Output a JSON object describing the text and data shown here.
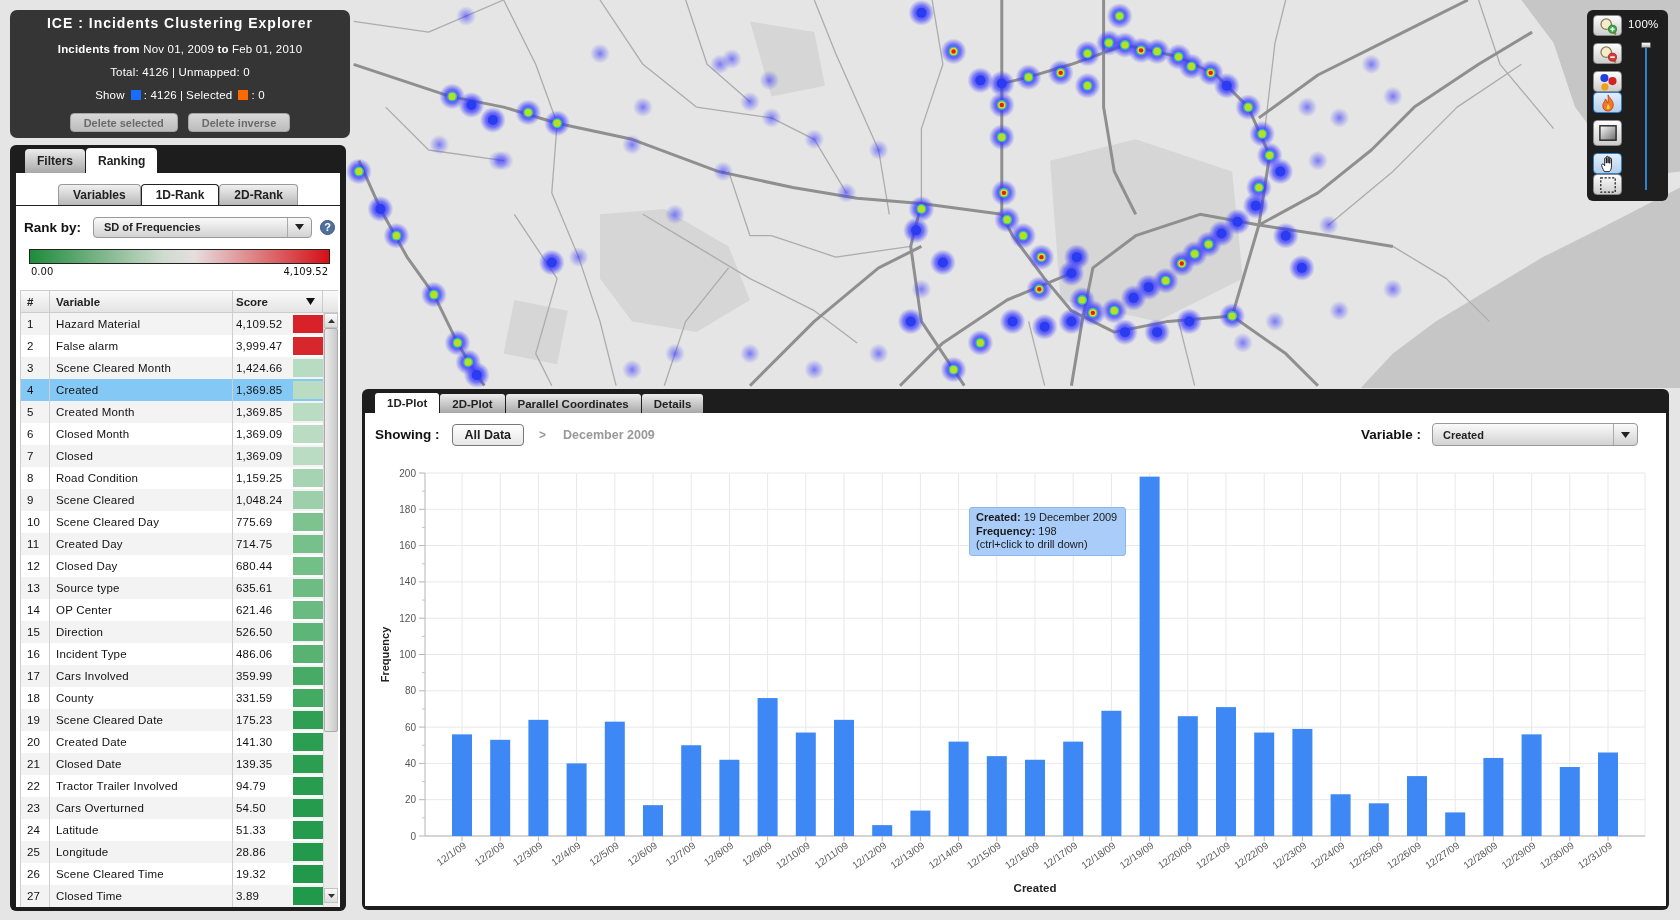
{
  "info_panel": {
    "title": "ICE : Incidents Clustering Explorer",
    "range": "**Incidents from** Nov 01, 2009 **to** Feb 01, 2010",
    "totals": "Total: 4126 | Unmapped: 0",
    "legend": [
      {
        "label": "Show",
        "color": "#1a6cff",
        "value": ": 4126"
      },
      {
        "label": "Selected",
        "color": "#ff6a00",
        "value": ": 0"
      }
    ],
    "legend_separator": "|",
    "buttons": [
      {
        "label": "Delete selected",
        "disabled": true
      },
      {
        "label": "Delete inverse",
        "disabled": true
      }
    ]
  },
  "ranking_panel": {
    "tabs": [
      {
        "label": "Filters",
        "selected": false
      },
      {
        "label": "Ranking",
        "selected": true
      }
    ],
    "subtabs": [
      {
        "label": "Variables",
        "selected": false
      },
      {
        "label": "1D-Rank",
        "selected": true
      },
      {
        "label": "2D-Rank",
        "selected": false
      }
    ],
    "rank_by": {
      "label": "Rank by:",
      "value": "SD of Frequencies",
      "help": "?"
    },
    "scale": {
      "min": "0.00",
      "max": "4,109.52"
    },
    "table": {
      "columns": [
        "#",
        "Variable",
        "Score"
      ],
      "rows": [
        {
          "rank": "1",
          "variable": "Hazard Material",
          "score": "4,109.52",
          "color": "#d7222a",
          "selected": false
        },
        {
          "rank": "2",
          "variable": "False alarm",
          "score": "3,999.47",
          "color": "#d8262d",
          "selected": false
        },
        {
          "rank": "3",
          "variable": "Scene Cleared Month",
          "score": "1,424.66",
          "color": "#b8dcc2",
          "selected": false
        },
        {
          "rank": "4",
          "variable": "Created",
          "score": "1,369.85",
          "color": "#b9dcc3",
          "selected": true
        },
        {
          "rank": "5",
          "variable": "Created Month",
          "score": "1,369.85",
          "color": "#b9dcc3",
          "selected": false
        },
        {
          "rank": "6",
          "variable": "Closed Month",
          "score": "1,369.09",
          "color": "#b9dcc3",
          "selected": false
        },
        {
          "rank": "7",
          "variable": "Closed",
          "score": "1,369.09",
          "color": "#b9dcc3",
          "selected": false
        },
        {
          "rank": "8",
          "variable": "Road Condition",
          "score": "1,159.25",
          "color": "#a6d4b2",
          "selected": false
        },
        {
          "rank": "9",
          "variable": "Scene Cleared",
          "score": "1,048.24",
          "color": "#9dd0aa",
          "selected": false
        },
        {
          "rank": "10",
          "variable": "Scene Cleared Day",
          "score": "775.69",
          "color": "#7cc38f",
          "selected": false
        },
        {
          "rank": "11",
          "variable": "Created Day",
          "score": "714.75",
          "color": "#76c18b",
          "selected": false
        },
        {
          "rank": "12",
          "variable": "Closed Day",
          "score": "680.44",
          "color": "#72bf87",
          "selected": false
        },
        {
          "rank": "13",
          "variable": "Source type",
          "score": "635.61",
          "color": "#6cbc83",
          "selected": false
        },
        {
          "rank": "14",
          "variable": "OP Center",
          "score": "621.46",
          "color": "#6abb81",
          "selected": false
        },
        {
          "rank": "15",
          "variable": "Direction",
          "score": "526.50",
          "color": "#5db577",
          "selected": false
        },
        {
          "rank": "16",
          "variable": "Incident Type",
          "score": "486.06",
          "color": "#58b373",
          "selected": false
        },
        {
          "rank": "17",
          "variable": "Cars Involved",
          "score": "359.99",
          "color": "#47ab65",
          "selected": false
        },
        {
          "rank": "18",
          "variable": "County",
          "score": "331.59",
          "color": "#43aa62",
          "selected": false
        },
        {
          "rank": "19",
          "variable": "Scene Cleared Date",
          "score": "175.23",
          "color": "#2f9f54",
          "selected": false
        },
        {
          "rank": "20",
          "variable": "Created Date",
          "score": "141.30",
          "color": "#2c9e52",
          "selected": false
        },
        {
          "rank": "21",
          "variable": "Closed Date",
          "score": "139.35",
          "color": "#2c9e52",
          "selected": false
        },
        {
          "rank": "22",
          "variable": "Tractor Trailer Involved",
          "score": "94.79",
          "color": "#289c4f",
          "selected": false
        },
        {
          "rank": "23",
          "variable": "Cars Overturned",
          "score": "54.50",
          "color": "#259b4d",
          "selected": false
        },
        {
          "rank": "24",
          "variable": "Latitude",
          "score": "51.33",
          "color": "#259b4d",
          "selected": false
        },
        {
          "rank": "25",
          "variable": "Longitude",
          "score": "28.86",
          "color": "#239a4b",
          "selected": false
        },
        {
          "rank": "26",
          "variable": "Scene Cleared Time",
          "score": "19.32",
          "color": "#22994a",
          "selected": false
        },
        {
          "rank": "27",
          "variable": "Closed Time",
          "score": "3.89",
          "color": "#21994a",
          "selected": false
        }
      ]
    }
  },
  "plot_panel": {
    "tabs": [
      {
        "label": "1D-Plot",
        "selected": true
      },
      {
        "label": "2D-Plot",
        "selected": false
      },
      {
        "label": "Parallel Coordinates",
        "selected": false
      },
      {
        "label": "Details",
        "selected": false
      }
    ],
    "showing": {
      "label": "Showing :",
      "root": "All Data",
      "separator": ">",
      "current": "December 2009"
    },
    "variable": {
      "label": "Variable :",
      "value": "Created"
    },
    "chart_data": {
      "type": "bar",
      "xlabel": "Created",
      "ylabel": "Frequency",
      "categories": [
        "12/1/09",
        "12/2/09",
        "12/3/09",
        "12/4/09",
        "12/5/09",
        "12/6/09",
        "12/7/09",
        "12/8/09",
        "12/9/09",
        "12/10/09",
        "12/11/09",
        "12/12/09",
        "12/13/09",
        "12/14/09",
        "12/15/09",
        "12/16/09",
        "12/17/09",
        "12/18/09",
        "12/19/09",
        "12/20/09",
        "12/21/09",
        "12/22/09",
        "12/23/09",
        "12/24/09",
        "12/25/09",
        "12/26/09",
        "12/27/09",
        "12/28/09",
        "12/29/09",
        "12/30/09",
        "12/31/09"
      ],
      "values": [
        56,
        53,
        64,
        40,
        63,
        17,
        50,
        42,
        76,
        57,
        64,
        6,
        14,
        52,
        44,
        42,
        52,
        69,
        198,
        66,
        71,
        57,
        59,
        23,
        18,
        33,
        13,
        43,
        56,
        38,
        46
      ],
      "ylim": [
        0,
        200
      ],
      "yticks": [
        0,
        20,
        40,
        60,
        80,
        100,
        120,
        140,
        160,
        180,
        200
      ],
      "grid": true
    },
    "tooltip": {
      "lines": [
        "**Created:** 19 December 2009",
        "**Frequency:** 198",
        "(ctrl+click to drill down)"
      ]
    }
  },
  "map_tools": {
    "groups": [
      {
        "tools": [
          {
            "kind": "zoom-in",
            "selected": false
          }
        ]
      },
      {
        "tools": [
          {
            "kind": "zoom-out",
            "selected": false
          }
        ]
      },
      {
        "tools": [
          {
            "kind": "dots",
            "selected": false
          },
          {
            "kind": "flame",
            "selected": true
          }
        ]
      },
      {
        "tools": [
          {
            "kind": "gradient",
            "selected": false
          }
        ]
      },
      {
        "tools": [
          {
            "kind": "hand",
            "selected": true
          },
          {
            "kind": "select",
            "selected": false
          }
        ]
      }
    ],
    "zoom": {
      "label": "100%",
      "level": 1
    }
  }
}
